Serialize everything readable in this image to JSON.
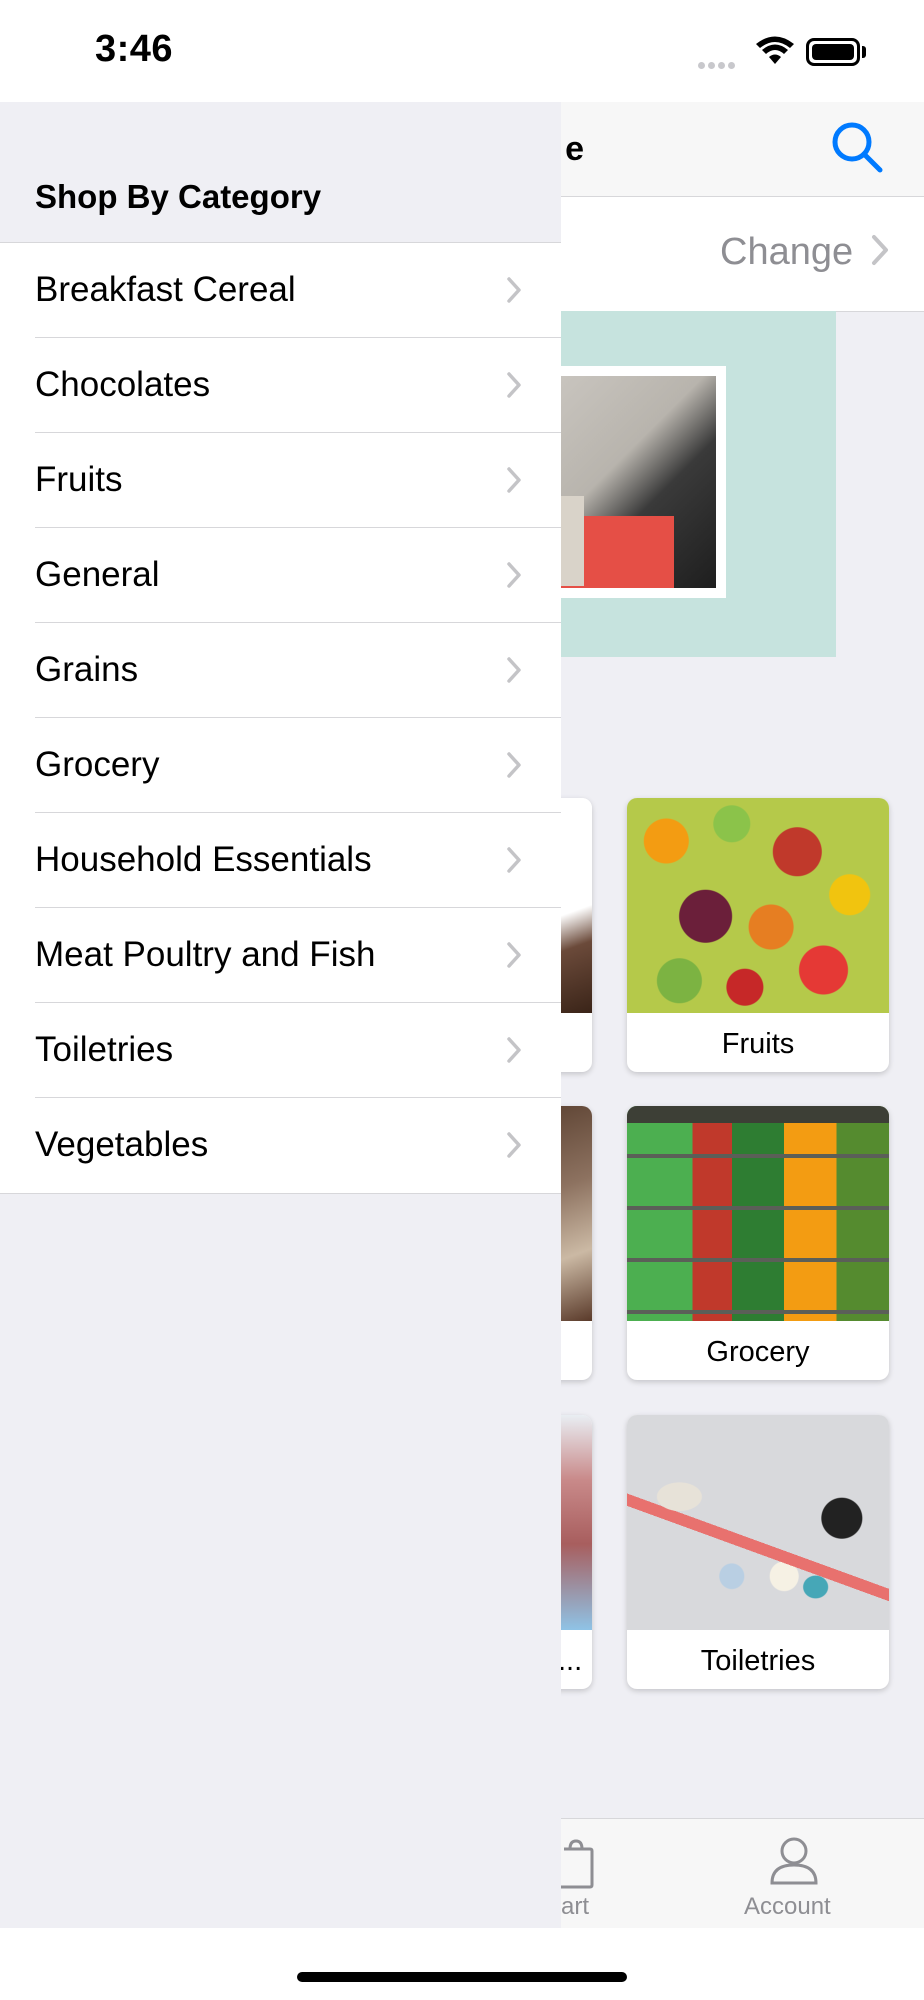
{
  "status_bar": {
    "time": "3:46"
  },
  "background_screen": {
    "title_fragment": "e",
    "location": {
      "change_label": "Change"
    },
    "category_cards": [
      {
        "label": "Fruits"
      },
      {
        "label": "Grocery"
      },
      {
        "label": "Toiletries"
      }
    ],
    "partial_card_label": "...",
    "tab_bar": {
      "cart_label": "art",
      "account_label": "Account"
    }
  },
  "side_menu": {
    "title": "Shop By Category",
    "items": [
      {
        "label": "Breakfast Cereal"
      },
      {
        "label": "Chocolates"
      },
      {
        "label": "Fruits"
      },
      {
        "label": "General"
      },
      {
        "label": "Grains"
      },
      {
        "label": "Grocery"
      },
      {
        "label": "Household Essentials"
      },
      {
        "label": "Meat Poultry and Fish"
      },
      {
        "label": "Toiletries"
      },
      {
        "label": "Vegetables"
      }
    ]
  },
  "colors": {
    "accent": "#007aff",
    "menu_background": "#efeff4",
    "banner": "#c6e3de",
    "secondary_text": "#8e8e93"
  },
  "icons": [
    "search-icon",
    "chevron-right-icon",
    "cart-icon",
    "account-icon",
    "wifi-icon",
    "battery-icon"
  ]
}
